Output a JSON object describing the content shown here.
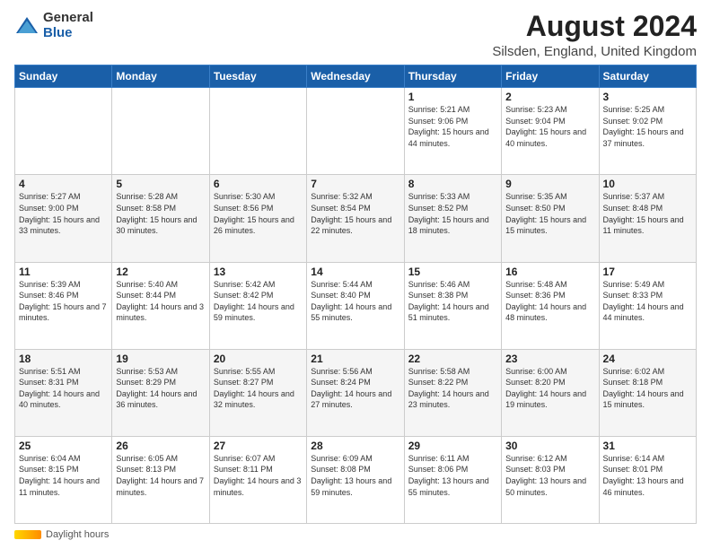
{
  "header": {
    "logo_general": "General",
    "logo_blue": "Blue",
    "title": "August 2024",
    "subtitle": "Silsden, England, United Kingdom"
  },
  "days_of_week": [
    "Sunday",
    "Monday",
    "Tuesday",
    "Wednesday",
    "Thursday",
    "Friday",
    "Saturday"
  ],
  "weeks": [
    [
      {
        "day": "",
        "info": ""
      },
      {
        "day": "",
        "info": ""
      },
      {
        "day": "",
        "info": ""
      },
      {
        "day": "",
        "info": ""
      },
      {
        "day": "1",
        "info": "Sunrise: 5:21 AM\nSunset: 9:06 PM\nDaylight: 15 hours and 44 minutes."
      },
      {
        "day": "2",
        "info": "Sunrise: 5:23 AM\nSunset: 9:04 PM\nDaylight: 15 hours and 40 minutes."
      },
      {
        "day": "3",
        "info": "Sunrise: 5:25 AM\nSunset: 9:02 PM\nDaylight: 15 hours and 37 minutes."
      }
    ],
    [
      {
        "day": "4",
        "info": "Sunrise: 5:27 AM\nSunset: 9:00 PM\nDaylight: 15 hours and 33 minutes."
      },
      {
        "day": "5",
        "info": "Sunrise: 5:28 AM\nSunset: 8:58 PM\nDaylight: 15 hours and 30 minutes."
      },
      {
        "day": "6",
        "info": "Sunrise: 5:30 AM\nSunset: 8:56 PM\nDaylight: 15 hours and 26 minutes."
      },
      {
        "day": "7",
        "info": "Sunrise: 5:32 AM\nSunset: 8:54 PM\nDaylight: 15 hours and 22 minutes."
      },
      {
        "day": "8",
        "info": "Sunrise: 5:33 AM\nSunset: 8:52 PM\nDaylight: 15 hours and 18 minutes."
      },
      {
        "day": "9",
        "info": "Sunrise: 5:35 AM\nSunset: 8:50 PM\nDaylight: 15 hours and 15 minutes."
      },
      {
        "day": "10",
        "info": "Sunrise: 5:37 AM\nSunset: 8:48 PM\nDaylight: 15 hours and 11 minutes."
      }
    ],
    [
      {
        "day": "11",
        "info": "Sunrise: 5:39 AM\nSunset: 8:46 PM\nDaylight: 15 hours and 7 minutes."
      },
      {
        "day": "12",
        "info": "Sunrise: 5:40 AM\nSunset: 8:44 PM\nDaylight: 14 hours and 3 minutes."
      },
      {
        "day": "13",
        "info": "Sunrise: 5:42 AM\nSunset: 8:42 PM\nDaylight: 14 hours and 59 minutes."
      },
      {
        "day": "14",
        "info": "Sunrise: 5:44 AM\nSunset: 8:40 PM\nDaylight: 14 hours and 55 minutes."
      },
      {
        "day": "15",
        "info": "Sunrise: 5:46 AM\nSunset: 8:38 PM\nDaylight: 14 hours and 51 minutes."
      },
      {
        "day": "16",
        "info": "Sunrise: 5:48 AM\nSunset: 8:36 PM\nDaylight: 14 hours and 48 minutes."
      },
      {
        "day": "17",
        "info": "Sunrise: 5:49 AM\nSunset: 8:33 PM\nDaylight: 14 hours and 44 minutes."
      }
    ],
    [
      {
        "day": "18",
        "info": "Sunrise: 5:51 AM\nSunset: 8:31 PM\nDaylight: 14 hours and 40 minutes."
      },
      {
        "day": "19",
        "info": "Sunrise: 5:53 AM\nSunset: 8:29 PM\nDaylight: 14 hours and 36 minutes."
      },
      {
        "day": "20",
        "info": "Sunrise: 5:55 AM\nSunset: 8:27 PM\nDaylight: 14 hours and 32 minutes."
      },
      {
        "day": "21",
        "info": "Sunrise: 5:56 AM\nSunset: 8:24 PM\nDaylight: 14 hours and 27 minutes."
      },
      {
        "day": "22",
        "info": "Sunrise: 5:58 AM\nSunset: 8:22 PM\nDaylight: 14 hours and 23 minutes."
      },
      {
        "day": "23",
        "info": "Sunrise: 6:00 AM\nSunset: 8:20 PM\nDaylight: 14 hours and 19 minutes."
      },
      {
        "day": "24",
        "info": "Sunrise: 6:02 AM\nSunset: 8:18 PM\nDaylight: 14 hours and 15 minutes."
      }
    ],
    [
      {
        "day": "25",
        "info": "Sunrise: 6:04 AM\nSunset: 8:15 PM\nDaylight: 14 hours and 11 minutes."
      },
      {
        "day": "26",
        "info": "Sunrise: 6:05 AM\nSunset: 8:13 PM\nDaylight: 14 hours and 7 minutes."
      },
      {
        "day": "27",
        "info": "Sunrise: 6:07 AM\nSunset: 8:11 PM\nDaylight: 14 hours and 3 minutes."
      },
      {
        "day": "28",
        "info": "Sunrise: 6:09 AM\nSunset: 8:08 PM\nDaylight: 13 hours and 59 minutes."
      },
      {
        "day": "29",
        "info": "Sunrise: 6:11 AM\nSunset: 8:06 PM\nDaylight: 13 hours and 55 minutes."
      },
      {
        "day": "30",
        "info": "Sunrise: 6:12 AM\nSunset: 8:03 PM\nDaylight: 13 hours and 50 minutes."
      },
      {
        "day": "31",
        "info": "Sunrise: 6:14 AM\nSunset: 8:01 PM\nDaylight: 13 hours and 46 minutes."
      }
    ]
  ],
  "footer": {
    "daylight_label": "Daylight hours"
  }
}
